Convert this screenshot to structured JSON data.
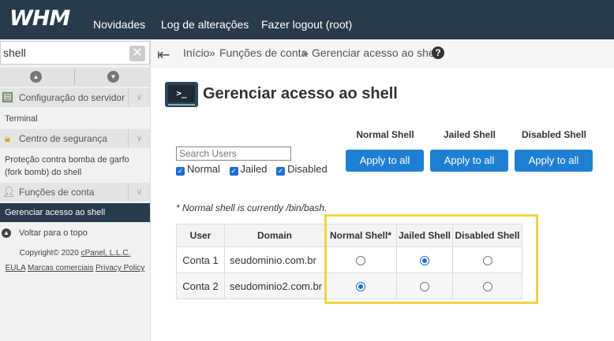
{
  "header": {
    "logo": "WHM",
    "nav": [
      "Novidades",
      "Log de alterações",
      "Fazer logout (root)"
    ]
  },
  "sidebar": {
    "search_value": "shell",
    "clear_label": "✕",
    "categories": [
      {
        "label": "Configuração do servidor",
        "icon": "server-icon"
      },
      {
        "label": "Centro de segurança",
        "icon": "lock-icon"
      },
      {
        "label": "Funções de conta",
        "icon": "user-icon"
      }
    ],
    "items": {
      "terminal": "Terminal",
      "fork_bomb": "Proteção contra bomba de garfo (fork bomb) do shell",
      "manage_shell": "Gerenciar acesso ao shell"
    },
    "back_to_top": "Voltar para o topo",
    "copyright": "Copyright© 2020",
    "copyright_link": "cPanel, L.L.C.",
    "footer_links": [
      "EULA",
      "Marcas comerciais",
      "Privacy Policy"
    ]
  },
  "breadcrumb": {
    "home": "Início",
    "sep": "»",
    "section": "Funções de conta",
    "current": "Gerenciar acesso ao shell",
    "help": "?"
  },
  "page": {
    "title": "Gerenciar acesso ao shell",
    "terminal_glyph": ">_",
    "search_placeholder": "Search Users",
    "filters": [
      "Normal",
      "Jailed",
      "Disabled"
    ],
    "shell_columns": [
      {
        "header": "Normal Shell",
        "button": "Apply to all"
      },
      {
        "header": "Jailed Shell",
        "button": "Apply to all"
      },
      {
        "header": "Disabled Shell",
        "button": "Apply to all"
      }
    ],
    "note": "* Normal shell is currently /bin/bash."
  },
  "table": {
    "headers": [
      "User",
      "Domain",
      "Normal Shell*",
      "Jailed Shell",
      "Disabled Shell"
    ],
    "rows": [
      {
        "user": "Conta 1",
        "domain": "seudominio.com.br",
        "selected": "jailed"
      },
      {
        "user": "Conta 2",
        "domain": "seudominio2.com.br",
        "selected": "normal"
      }
    ]
  },
  "colors": {
    "topbar": "#293a4a",
    "button": "#1f80d3",
    "highlight": "#f0d443"
  }
}
